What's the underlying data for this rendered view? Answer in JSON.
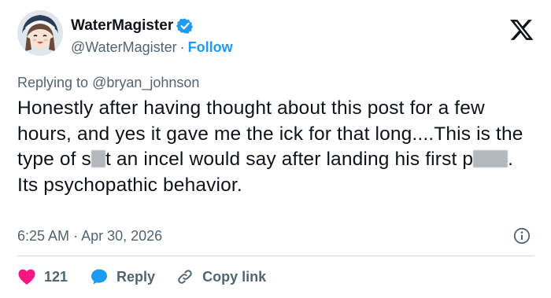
{
  "author": {
    "display_name": "WaterMagister",
    "handle": "@WaterMagister",
    "follow_label": "Follow",
    "separator": "·"
  },
  "reply": {
    "prefix": "Replying to ",
    "mention": "@bryan_johnson"
  },
  "tweet": {
    "seg1": "Honestly after having thought about this post for a few hours, and yes it gave me the ick for that long....This is the type of s",
    "seg2": "t an incel would say after landing his first p",
    "seg3": ". Its psychopathic behavior."
  },
  "meta": {
    "time": "6:25 AM",
    "separator": "·",
    "date": "Apr 30, 2026"
  },
  "actions": {
    "like_count": "121",
    "reply_label": "Reply",
    "copy_link_label": "Copy link"
  },
  "colors": {
    "accent": "#1d9bf0",
    "like": "#f91880",
    "muted": "#536471",
    "text": "#0f1419"
  },
  "icons": [
    "verified-badge-icon",
    "x-logo-icon",
    "info-icon",
    "heart-icon",
    "reply-bubble-icon",
    "link-icon"
  ]
}
